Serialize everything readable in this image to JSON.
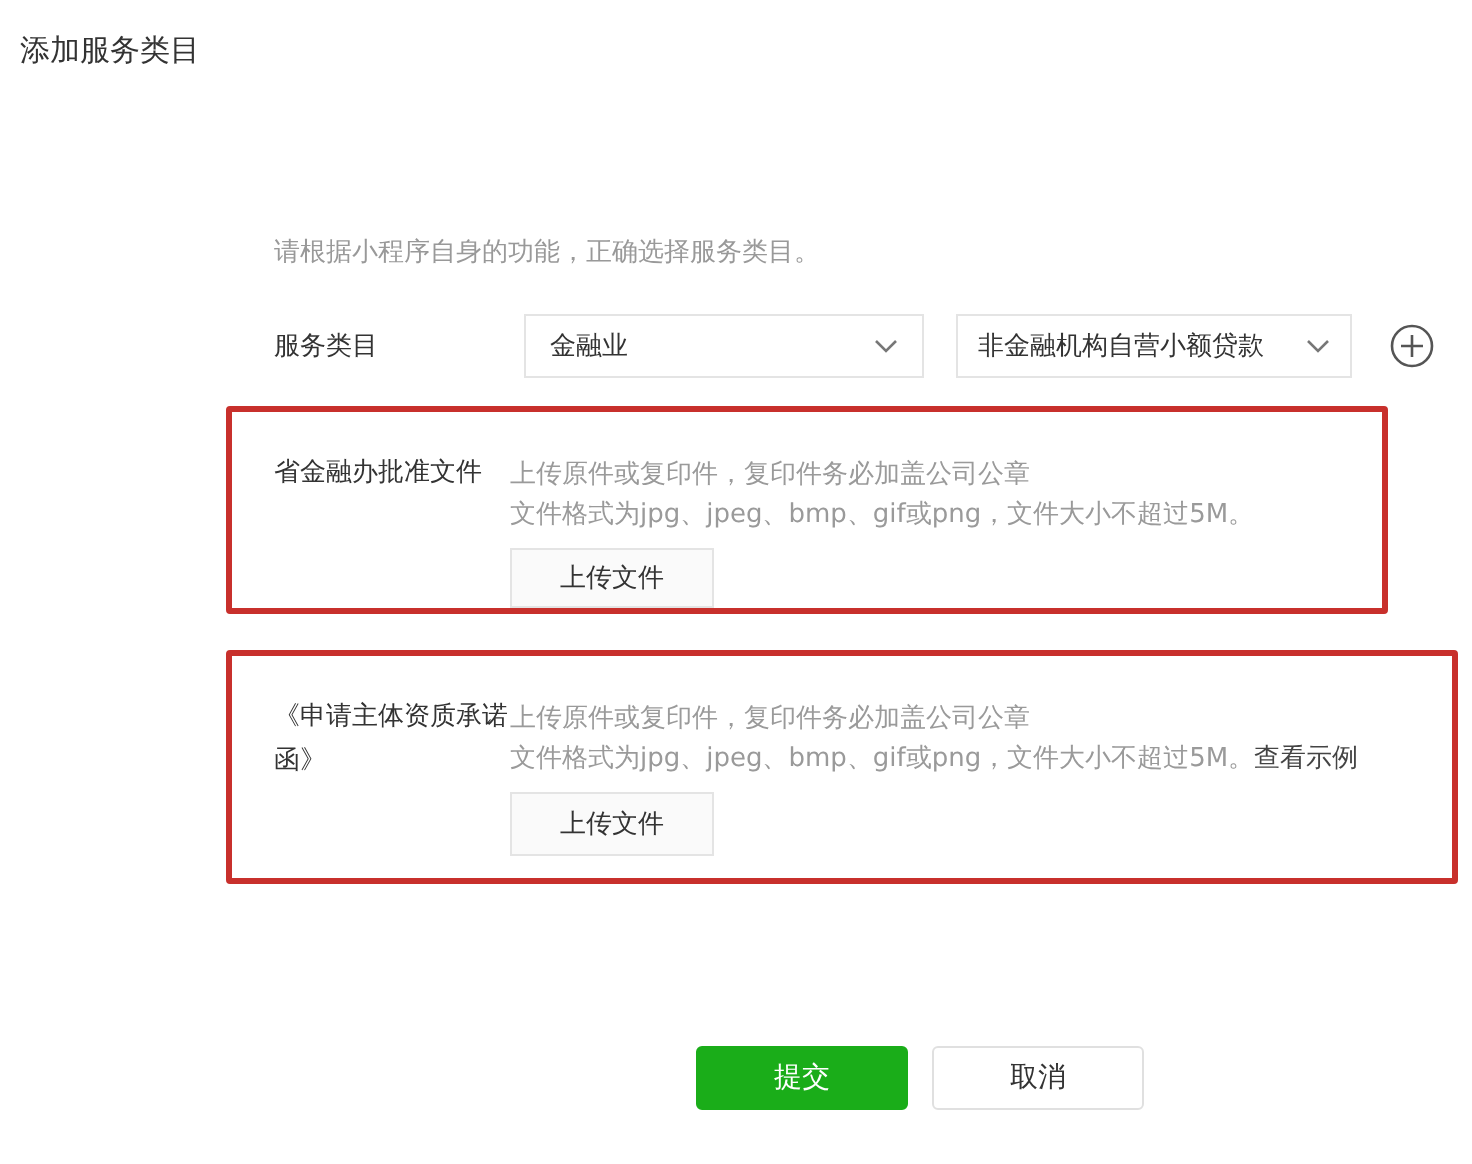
{
  "window": {
    "title": "添加服务类目"
  },
  "hint": "请根据小程序自身的功能，正确选择服务类目。",
  "category": {
    "label": "服务类目",
    "selects": [
      {
        "value": "金融业"
      },
      {
        "value": "非金融机构自营小额贷款"
      }
    ]
  },
  "documents": [
    {
      "label": "省金融办批准文件",
      "lines": [
        "上传原件或复印件，复印件务必加盖公司公章",
        "文件格式为jpg、jpeg、bmp、gif或png，文件大小不超过5M。"
      ],
      "button": "上传文件"
    },
    {
      "label": "《申请主体资质承诺函》",
      "lines": [
        "上传原件或复印件，复印件务必加盖公司公章",
        "文件格式为jpg、jpeg、bmp、gif或png，文件大小不超过5M。"
      ],
      "link": "查看示例",
      "button": "上传文件"
    }
  ],
  "buttons": [
    {
      "label": "提交",
      "kind": "primary"
    },
    {
      "label": "取消",
      "kind": "default"
    }
  ]
}
